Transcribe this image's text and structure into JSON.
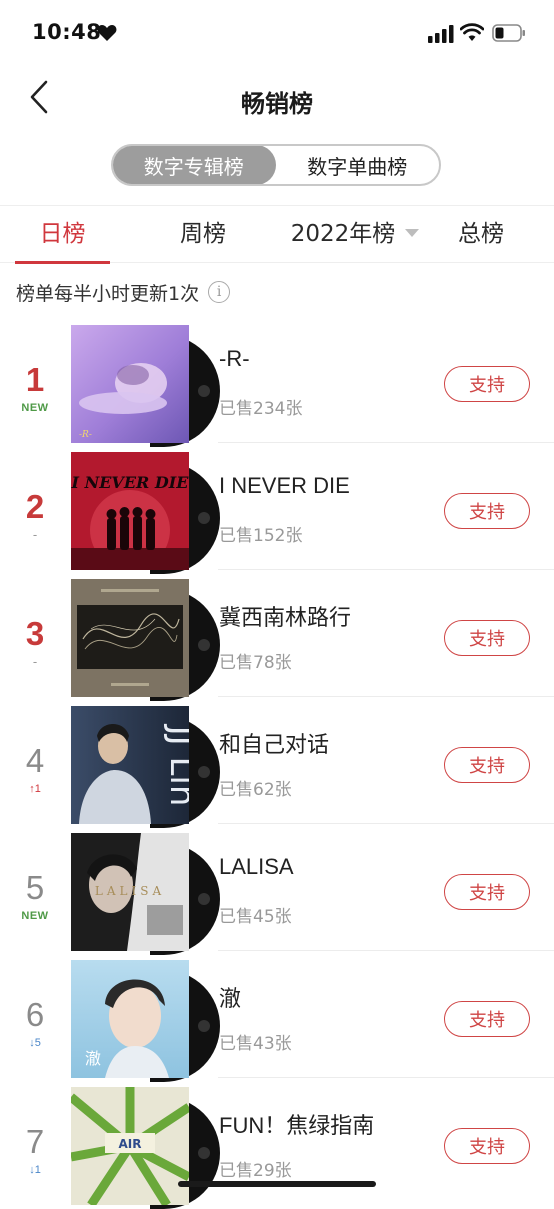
{
  "status_bar": {
    "time": "10:48",
    "heart_icon": "heart-icon",
    "signal_icon": "cellular-signal-icon",
    "wifi_icon": "wifi-icon",
    "battery_icon": "battery-icon"
  },
  "nav": {
    "back_icon": "chevron-left-icon",
    "title": "畅销榜"
  },
  "segment": {
    "options": [
      "数字专辑榜",
      "数字单曲榜"
    ],
    "selected": "数字专辑榜"
  },
  "tabs": {
    "items": [
      "日榜",
      "周榜",
      "2022年榜",
      "总榜"
    ],
    "active": "日榜",
    "dropdown_tab": "2022年榜"
  },
  "update_note": "榜单每半小时更新1次",
  "info_icon": "info-icon",
  "colors": {
    "accent": "#d0373d",
    "rank_top": "#c73a3a",
    "rank_normal": "#8a8a8a",
    "new_badge": "#4f9a47",
    "rank_down": "#4a86c8",
    "muted_text": "#999999"
  },
  "albums": [
    {
      "rank": "1",
      "change": "NEW",
      "change_type": "new",
      "title": "-R-",
      "sales": "已售234张",
      "button": "支持",
      "cover_text": "-R-"
    },
    {
      "rank": "2",
      "change": "-",
      "change_type": "same",
      "title": "I NEVER DIE",
      "sales": "已售152张",
      "button": "支持",
      "cover_text": "I NEVER DIE"
    },
    {
      "rank": "3",
      "change": "-",
      "change_type": "same",
      "title": "冀西南林路行",
      "sales": "已售78张",
      "button": "支持",
      "cover_text": ""
    },
    {
      "rank": "4",
      "change": "1",
      "change_type": "up",
      "title": "和自己对话",
      "sales": "已售62张",
      "button": "支持",
      "cover_text": "JJ Lin"
    },
    {
      "rank": "5",
      "change": "NEW",
      "change_type": "new",
      "title": "LALISA",
      "sales": "已售45张",
      "button": "支持",
      "cover_text": "LALISA"
    },
    {
      "rank": "6",
      "change": "5",
      "change_type": "down",
      "title": "澈",
      "sales": "已售43张",
      "button": "支持",
      "cover_text": "澈"
    },
    {
      "rank": "7",
      "change": "1",
      "change_type": "down",
      "title": "FUN！焦绿指南",
      "sales": "已售29张",
      "button": "支持",
      "cover_text": "AIR"
    }
  ]
}
